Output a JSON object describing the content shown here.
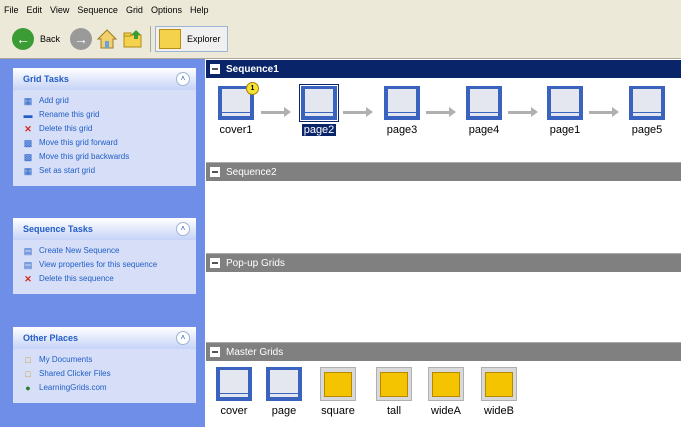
{
  "menu": [
    "File",
    "Edit",
    "View",
    "Sequence",
    "Grid",
    "Options",
    "Help"
  ],
  "toolbar": {
    "back_label": "Back",
    "explorer_label": "Explorer"
  },
  "sidebar": {
    "grid_tasks": {
      "title": "Grid Tasks",
      "items": [
        "Add grid",
        "Rename this grid",
        "Delete this grid",
        "Move this grid forward",
        "Move this grid backwards",
        "Set as start grid"
      ]
    },
    "sequence_tasks": {
      "title": "Sequence Tasks",
      "items": [
        "Create New Sequence",
        "View properties for this sequence",
        "Delete this sequence"
      ]
    },
    "other_places": {
      "title": "Other Places",
      "items": [
        "My Documents",
        "Shared Clicker Files",
        "LearningGrids.com"
      ]
    }
  },
  "main": {
    "sequence1": {
      "title": "Sequence1",
      "grids": [
        "cover1",
        "page2",
        "page3",
        "page4",
        "page1",
        "page5"
      ],
      "badge": "1"
    },
    "sequence2": {
      "title": "Sequence2"
    },
    "popup": {
      "title": "Pop-up Grids"
    },
    "master": {
      "title": "Master Grids",
      "grids": [
        "cover",
        "page",
        "square",
        "tall",
        "wideA",
        "wideB"
      ]
    }
  }
}
